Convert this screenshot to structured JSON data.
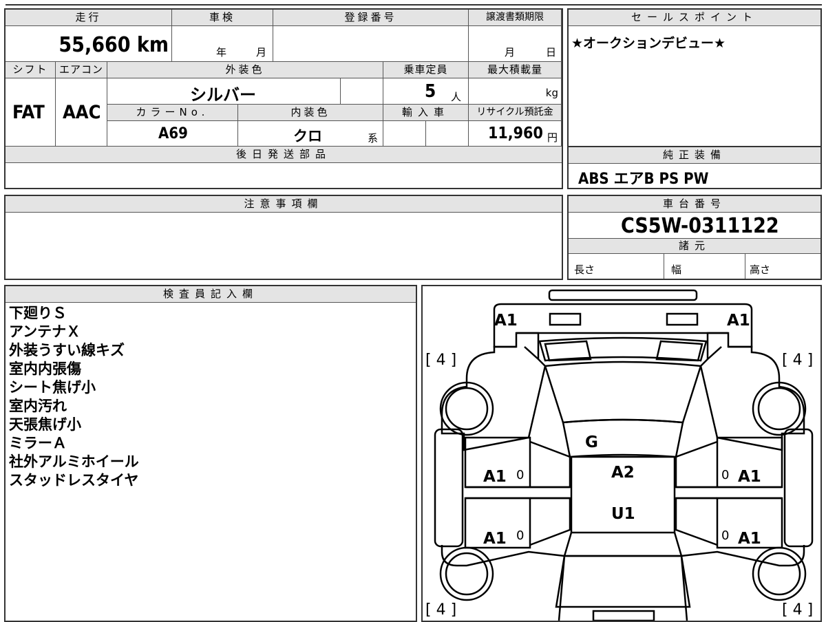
{
  "basic": {
    "mileage_label": "走行",
    "mileage": "55,660 km",
    "inspection_label": "車検",
    "year_unit": "年",
    "month_unit": "月",
    "registration_label": "登録番号",
    "transfer_deadline_label": "譲渡書類期限",
    "day_unit": "日",
    "shift_label": "シフト",
    "shift": "FAT",
    "ac_label": "エアコン",
    "ac": "AAC",
    "exterior_color_label": "外装色",
    "exterior_color": "シルバー",
    "capacity_label": "乗車定員",
    "capacity": "5",
    "capacity_unit": "人",
    "max_load_label": "最大積載量",
    "max_load_unit": "kg",
    "color_no_label": "カラーNo.",
    "color_no": "A69",
    "interior_color_label": "内装色",
    "interior_color": "クロ",
    "interior_suffix": "系",
    "import_label": "輸入車",
    "recycle_label": "リサイクル預託金",
    "recycle_fee": "11,960",
    "recycle_unit": "円",
    "later_parts_label": "後日発送部品"
  },
  "sales_point": {
    "label": "セールスポイント",
    "text": "★オークションデビュー★"
  },
  "standard_equipment": {
    "label": "純正装備",
    "text": "ABS エアB PS PW"
  },
  "notes": {
    "label": "注意事項欄"
  },
  "chassis": {
    "label": "車台番号",
    "number": "CS5W-0311122"
  },
  "specs": {
    "label": "諸元",
    "length": "長さ",
    "width": "幅",
    "height": "高さ"
  },
  "inspector": {
    "label": "検査員記入欄",
    "lines": [
      "下廻りＳ",
      "アンテナＸ",
      "外装うすい線キズ",
      "室内内張傷",
      "シート焦げ小",
      "室内汚れ",
      "天張焦げ小",
      "ミラーＡ",
      "社外アルミホイール",
      "スタッドレスタイヤ"
    ]
  },
  "diagram": {
    "marks": {
      "fl_bumper": "A1",
      "fr_bumper": "A1",
      "fl_tire": "[ 4 ]",
      "fr_tire": "[ 4 ]",
      "rl_tire": "[ 4 ]",
      "rr_tire": "[ 4 ]",
      "windshield": "G",
      "roof_front": "A2",
      "roof_rear": "U1",
      "front_left_door": "A1",
      "rear_left_door": "A1",
      "front_right_door": "A1",
      "rear_right_door": "A1",
      "zero": "0"
    }
  }
}
